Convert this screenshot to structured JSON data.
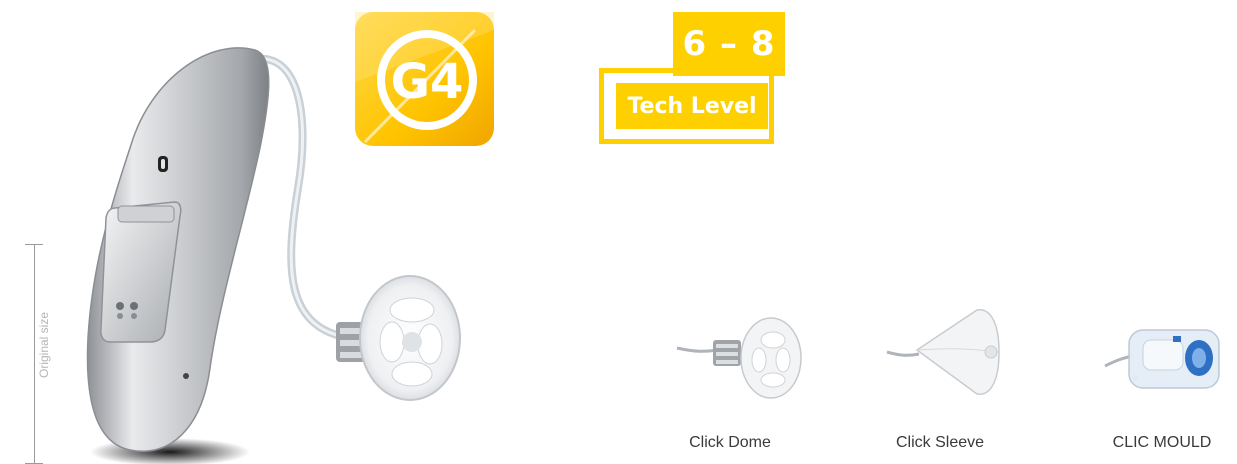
{
  "scale": {
    "label": "Original size"
  },
  "badges": {
    "generation": "G4",
    "tech_range": "6 – 8",
    "tech_label": "Tech Level"
  },
  "accessories": [
    {
      "label": "Click Dome",
      "icon": "click-dome"
    },
    {
      "label": "Click Sleeve",
      "icon": "click-sleeve"
    },
    {
      "label": "CLIC MOULD",
      "icon": "clic-mould"
    }
  ],
  "colors": {
    "badge_yellow": "#ffd000",
    "badge_orange": "#f5a800",
    "device_silver": "#b9bcc0",
    "label_gray": "#3a3a3a"
  }
}
